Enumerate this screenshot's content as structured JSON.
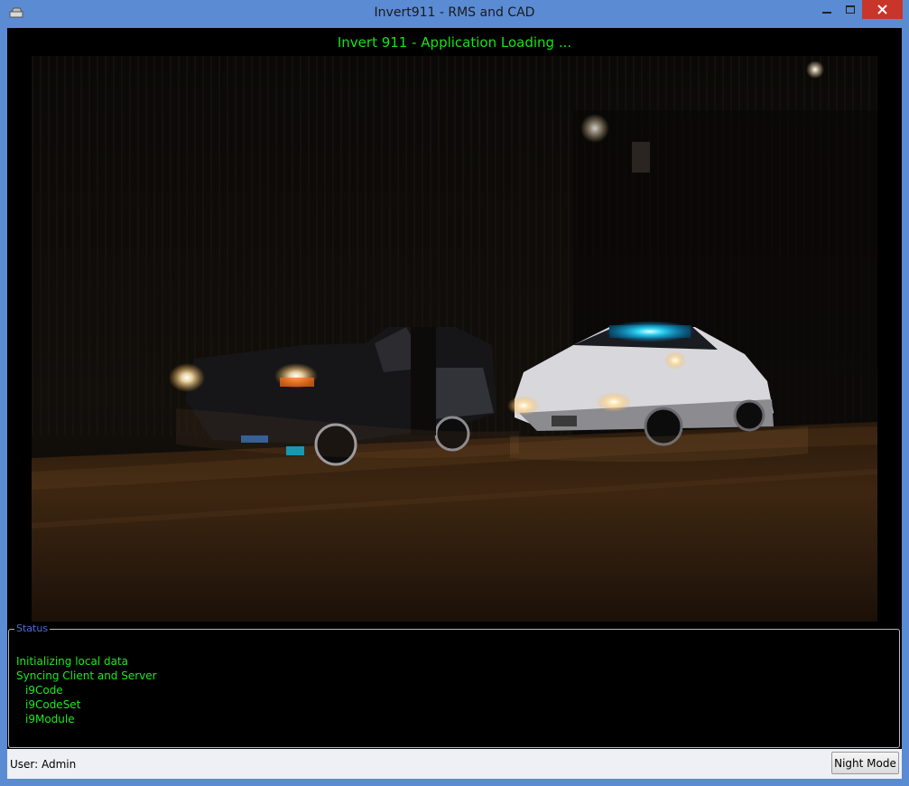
{
  "window": {
    "title": "Invert911 - RMS and CAD",
    "icon": "app-icon",
    "controls": [
      "minimize-icon",
      "maximize-icon",
      "close-icon"
    ]
  },
  "header": {
    "loading_text": "Invert 911 - Application Loading ..."
  },
  "splash_image": {
    "subject": "night scene: police cruiser with lights behind a pickup truck"
  },
  "status": {
    "legend": "Status",
    "lines": [
      "Initializing local data",
      "Syncing Client and Server",
      "i9Code",
      "i9CodeSet",
      "i9Module"
    ]
  },
  "footer": {
    "user_label": "User: Admin",
    "night_mode_label": "Night Mode"
  },
  "colors": {
    "accent_green": "#16e316",
    "legend_blue": "#4a72c8",
    "window_frame": "#5b8bd3",
    "close_red": "#c7352b"
  }
}
